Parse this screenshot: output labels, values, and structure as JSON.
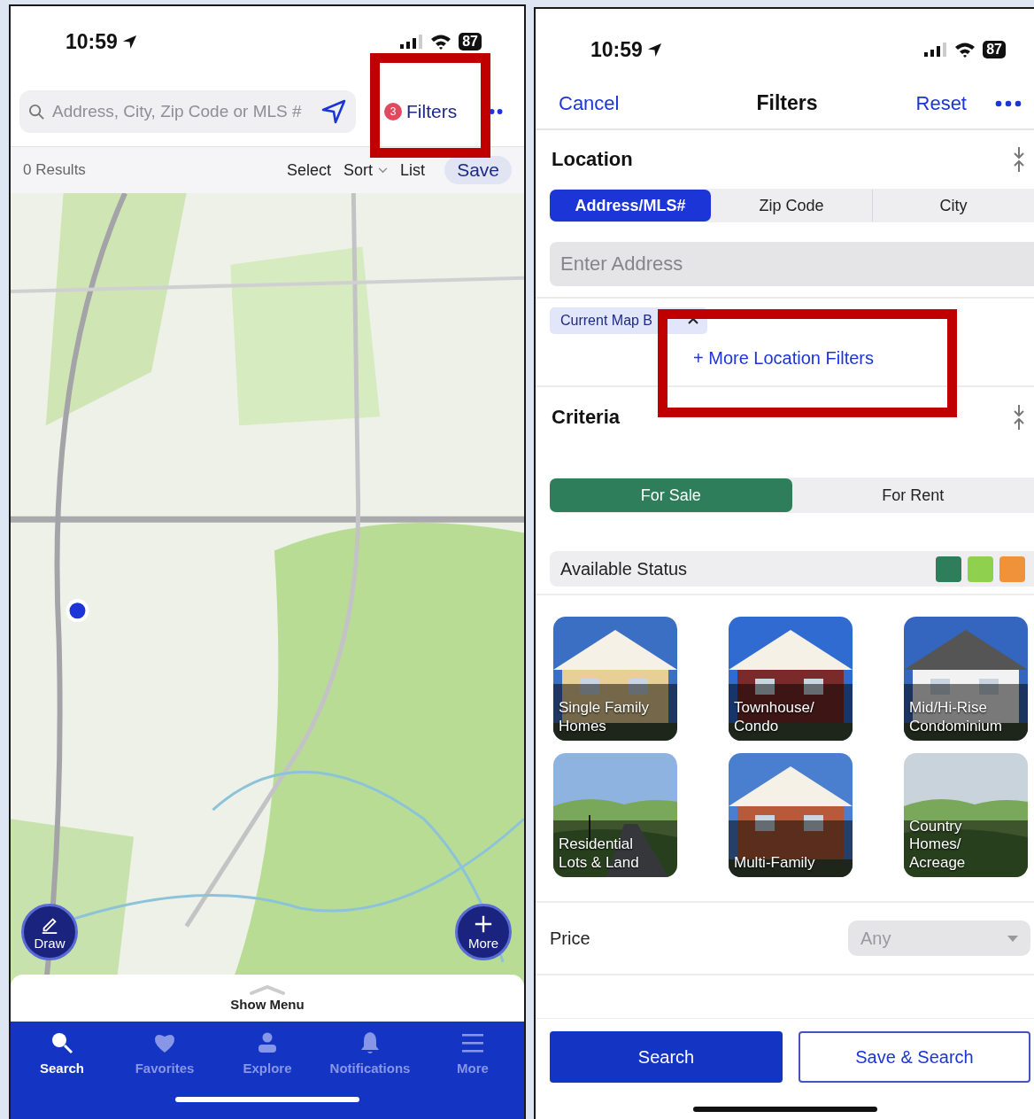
{
  "left_screen": {
    "status_bar": {
      "time": "10:59",
      "battery": "87"
    },
    "search": {
      "placeholder": "Address, City, Zip Code or MLS #"
    },
    "filters": {
      "label": "Filters",
      "badge": "3"
    },
    "results": "0 Results",
    "actions": [
      {
        "label": "Select",
        "kind": "text"
      },
      {
        "label": "Sort",
        "kind": "dropdown"
      },
      {
        "label": "List",
        "kind": "text"
      },
      {
        "label": "Save",
        "kind": "pill"
      }
    ],
    "map_buttons": [
      {
        "label": "Draw",
        "kind": "draw"
      },
      {
        "label": "More",
        "kind": "add"
      }
    ],
    "sheet": {
      "label": "Show Menu"
    },
    "tabs": [
      {
        "label": "Search",
        "selected": true
      },
      {
        "label": "Favorites",
        "selected": false
      },
      {
        "label": "Explore",
        "selected": false
      },
      {
        "label": "Notifications",
        "selected": false
      },
      {
        "label": "More",
        "selected": false
      }
    ]
  },
  "right_screen": {
    "status_bar": {
      "time": "10:59",
      "battery": "87"
    },
    "nav": {
      "cancel": "Cancel",
      "title": "Filters",
      "reset": "Reset"
    },
    "location": {
      "title": "Location",
      "modes": [
        {
          "label": "Address/MLS#",
          "selected": true
        },
        {
          "label": "Zip Code",
          "selected": false
        },
        {
          "label": "City",
          "selected": false
        }
      ],
      "address": {
        "placeholder": "Enter Address"
      },
      "chip": {
        "label": "Current Map B"
      },
      "more_link": "+ More Location Filters"
    },
    "criteria": {
      "title": "Criteria",
      "listing": [
        {
          "label": "For Sale",
          "selected": true
        },
        {
          "label": "For Rent",
          "selected": false
        }
      ],
      "status": {
        "label": "Available Status",
        "colors": [
          {
            "color": "#2e7d5b"
          },
          {
            "color": "#8fd14f"
          },
          {
            "color": "#f0923a"
          }
        ]
      },
      "property_types": [
        {
          "label": "Single Family\nHomes"
        },
        {
          "label": "Townhouse/\nCondo"
        },
        {
          "label": "Mid/Hi-Rise\nCondominium"
        },
        {
          "label": "Residential\nLots & Land"
        },
        {
          "label": "Multi-Family"
        },
        {
          "label": "Country\nHomes/\nAcreage"
        }
      ]
    },
    "price": {
      "label": "Price",
      "value": "Any"
    },
    "buttons": [
      {
        "label": "Search",
        "kind": "primary"
      },
      {
        "label": "Save & Search",
        "kind": "outline"
      }
    ]
  }
}
